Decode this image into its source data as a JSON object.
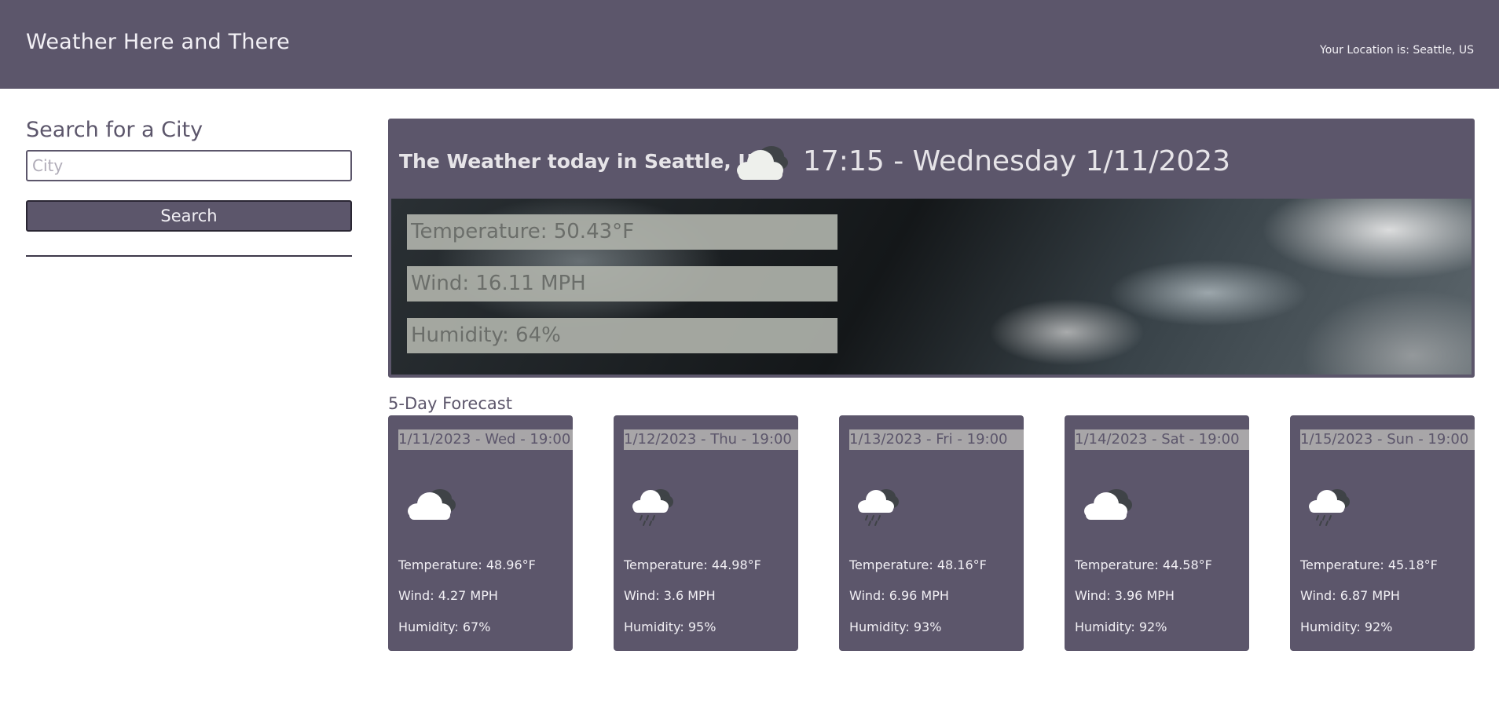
{
  "header": {
    "title": "Weather Here and There",
    "location": "Your Location is: Seattle, US"
  },
  "search": {
    "heading": "Search for a City",
    "placeholder": "City",
    "button_label": "Search"
  },
  "today": {
    "title": "The Weather today in Seattle, US",
    "icon": "cloudy-icon",
    "datetime": "17:15 - Wednesday 1/11/2023",
    "temperature": "Temperature: 50.43°F",
    "wind": "Wind: 16.11 MPH",
    "humidity": "Humidity: 64%"
  },
  "forecast": {
    "label": "5-Day Forecast",
    "days": [
      {
        "date": "1/11/2023 - Wed - 19:00",
        "icon": "cloudy-icon",
        "temperature": "Temperature: 48.96°F",
        "wind": "Wind: 4.27 MPH",
        "humidity": "Humidity: 67%"
      },
      {
        "date": "1/12/2023 - Thu - 19:00",
        "icon": "rain-icon",
        "temperature": "Temperature: 44.98°F",
        "wind": "Wind: 3.6 MPH",
        "humidity": "Humidity: 95%"
      },
      {
        "date": "1/13/2023 - Fri - 19:00",
        "icon": "rain-icon",
        "temperature": "Temperature: 48.16°F",
        "wind": "Wind: 6.96 MPH",
        "humidity": "Humidity: 93%"
      },
      {
        "date": "1/14/2023 - Sat - 19:00",
        "icon": "cloudy-icon",
        "temperature": "Temperature: 44.58°F",
        "wind": "Wind: 3.96 MPH",
        "humidity": "Humidity: 92%"
      },
      {
        "date": "1/15/2023 - Sun - 19:00",
        "icon": "rain-icon",
        "temperature": "Temperature: 45.18°F",
        "wind": "Wind: 6.87 MPH",
        "humidity": "Humidity: 92%"
      }
    ]
  },
  "colors": {
    "brand": "#5c566b",
    "text_light": "#f2f0f5",
    "date_bar": "#a8a6a8"
  }
}
